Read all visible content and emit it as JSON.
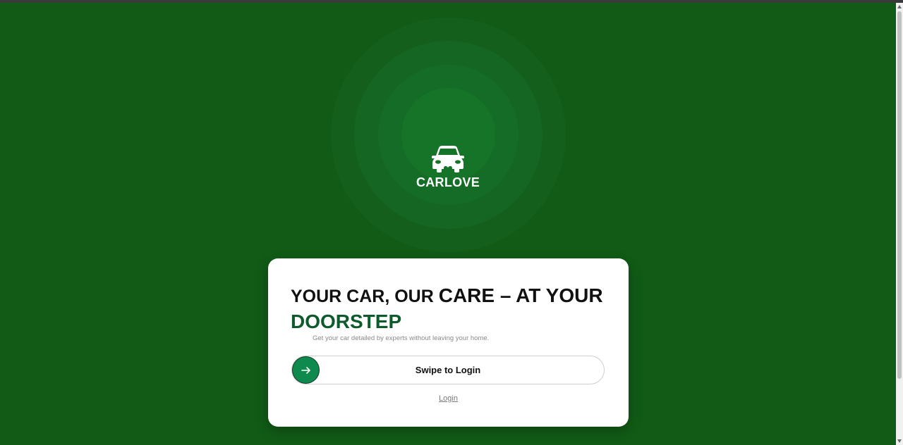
{
  "brand": {
    "name": "CARLOVE",
    "logo_icon": "car-heart-icon"
  },
  "card": {
    "headline_part1": "YOUR CAR, OUR ",
    "headline_part2": "CARE – AT YOUR",
    "headline_part3": "DOORSTEP",
    "subtitle": "Get your car detailed by experts without leaving your home.",
    "swipe_label": "Swipe to Login",
    "swipe_icon": "arrow-right-icon",
    "login_link": "Login"
  },
  "colors": {
    "background": "#115b16",
    "accent_green": "#0f8a4e",
    "headline_green": "#0e5a2c",
    "card": "#ffffff"
  }
}
